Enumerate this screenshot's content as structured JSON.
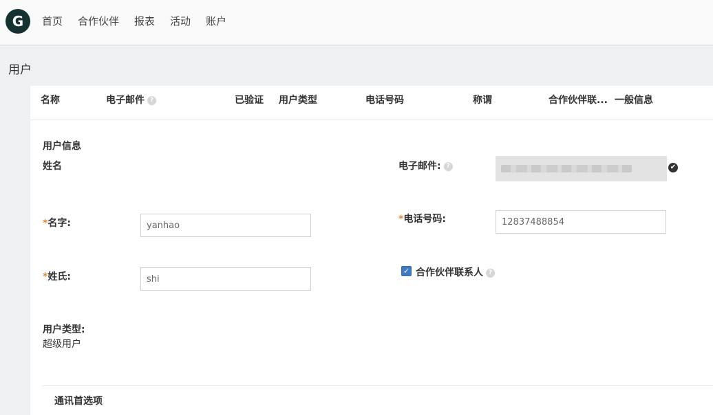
{
  "nav": {
    "logo_letter": "G",
    "items": [
      "首页",
      "合作伙伴",
      "报表",
      "活动",
      "账户"
    ]
  },
  "page_title": "用户",
  "columns": {
    "name": "名称",
    "email": "电子邮件",
    "verified": "已验证",
    "user_type": "用户类型",
    "phone": "电话号码",
    "salutation": "称谓",
    "partner_contact": "合作伙伴联...",
    "general_info": "一般信息"
  },
  "form": {
    "section_title": "用户信息",
    "name_heading": "姓名",
    "required_mark": "*",
    "first_name_label": "名字:",
    "first_name_value": "yanhao",
    "last_name_label": "姓氏:",
    "last_name_value": "shi",
    "user_type_label": "用户类型:",
    "user_type_value": "超级用户",
    "email_label": "电子邮件:",
    "phone_label": "电话号码:",
    "phone_value": "12837488854",
    "partner_contact_label": "合作伙伴联系人",
    "partner_contact_checked": true
  },
  "comm_prefs_title": "通讯首选项",
  "icons": {
    "help": "?",
    "check": "✓",
    "verified": "✔"
  }
}
